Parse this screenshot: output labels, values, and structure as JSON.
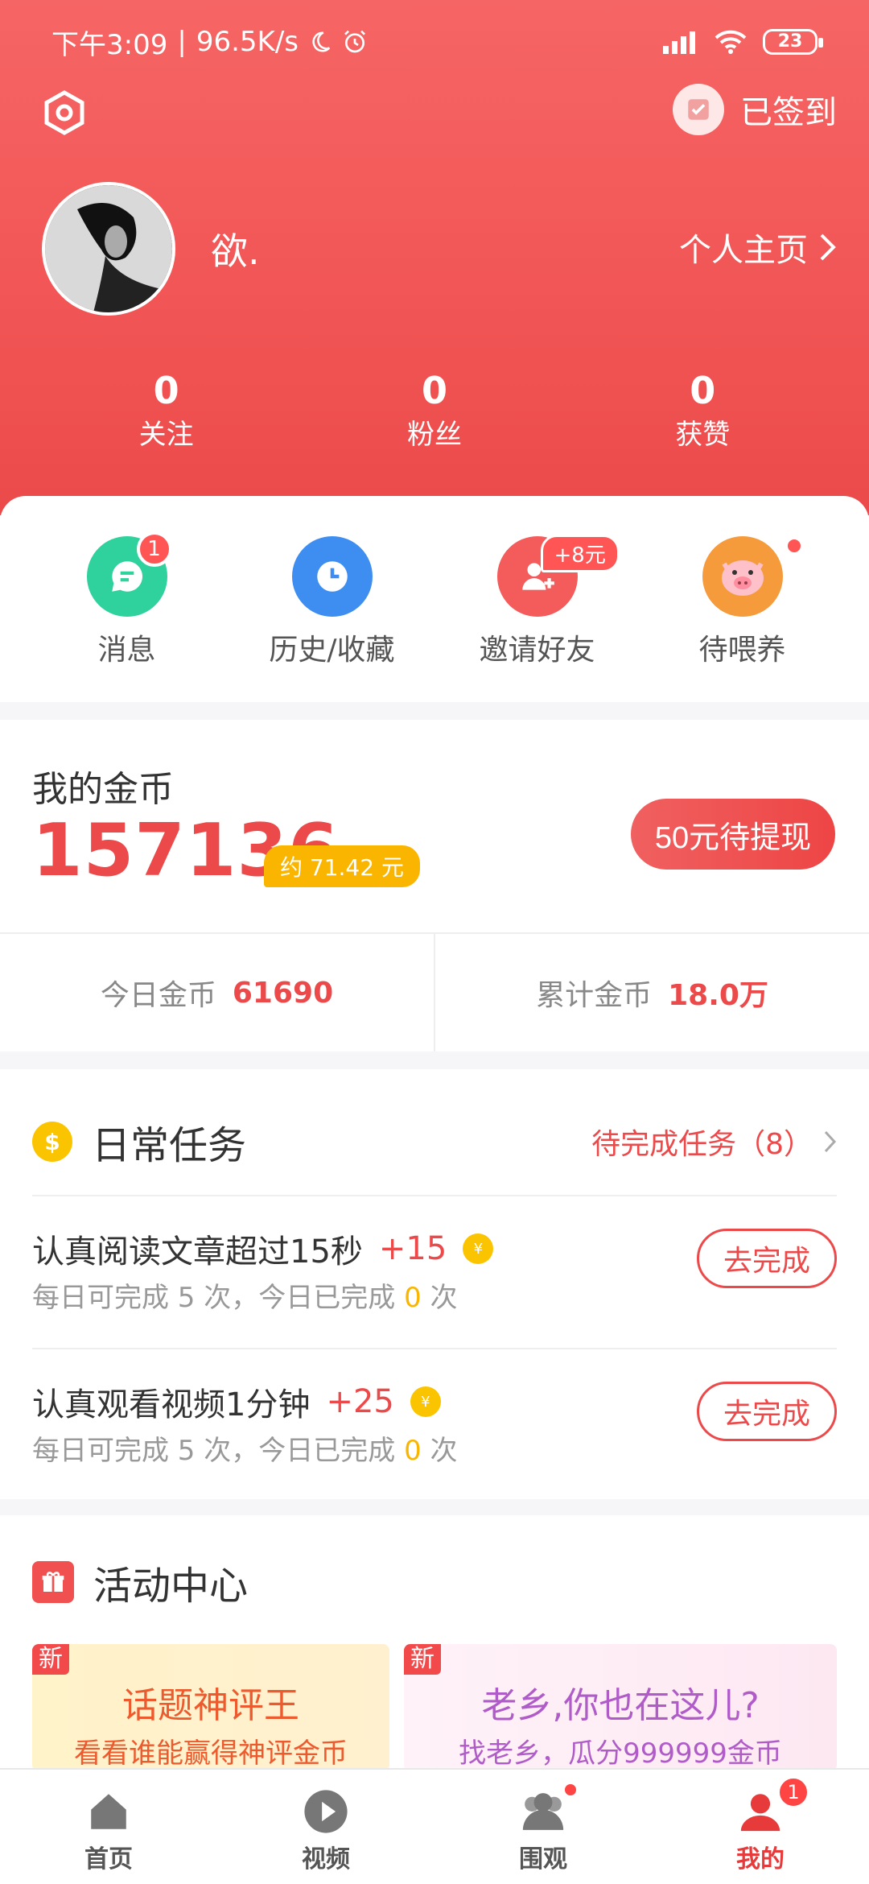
{
  "status_bar": {
    "time": "下午3:09",
    "speed": "96.5K/s",
    "battery": "23"
  },
  "header": {
    "checkin_label": "已签到",
    "username": "欲.",
    "profile_link": "个人主页"
  },
  "stats": [
    {
      "value": "0",
      "label": "关注"
    },
    {
      "value": "0",
      "label": "粉丝"
    },
    {
      "value": "0",
      "label": "获赞"
    }
  ],
  "quick_actions": [
    {
      "label": "消息",
      "badge": "1",
      "color": "#2fd19c"
    },
    {
      "label": "历史/收藏",
      "color": "#3d8ef0"
    },
    {
      "label": "邀请好友",
      "tag": "+8元",
      "color": "#f45b5b"
    },
    {
      "label": "待喂养",
      "color": "#f59b3c"
    }
  ],
  "coins": {
    "title": "我的金币",
    "amount": "157136",
    "approx": "约 71.42 元",
    "withdraw_label": "50元待提现",
    "today_label": "今日金币",
    "today_value": "61690",
    "total_label": "累计金币",
    "total_value": "18.0万"
  },
  "tasks": {
    "title": "日常任务",
    "pending_label": "待完成任务（8）",
    "coin_symbol": "$",
    "small_coin_symbol": "¥",
    "items": [
      {
        "title": "认真阅读文章超过15秒",
        "reward": "+15",
        "desc_prefix": "每日可完成 5 次，今日已完成 ",
        "done": "0",
        "desc_suffix": " 次",
        "button": "去完成"
      },
      {
        "title": "认真观看视频1分钟",
        "reward": "+25",
        "desc_prefix": "每日可完成 5 次，今日已完成 ",
        "done": "0",
        "desc_suffix": " 次",
        "button": "去完成"
      }
    ]
  },
  "activity": {
    "title": "活动中心",
    "cards": [
      {
        "badge": "新",
        "title": "话题神评王",
        "subtitle": "看看谁能赢得神评金币"
      },
      {
        "badge": "新",
        "title": "老乡,你也在这儿?",
        "subtitle": "找老乡，瓜分999999金币"
      }
    ]
  },
  "tabbar": {
    "items": [
      {
        "label": "首页",
        "icon": "home-icon"
      },
      {
        "label": "视频",
        "icon": "play-icon"
      },
      {
        "label": "围观",
        "icon": "people-icon"
      },
      {
        "label": "我的",
        "icon": "user-icon",
        "badge": "1"
      }
    ],
    "active_color": "#e73a3a"
  }
}
